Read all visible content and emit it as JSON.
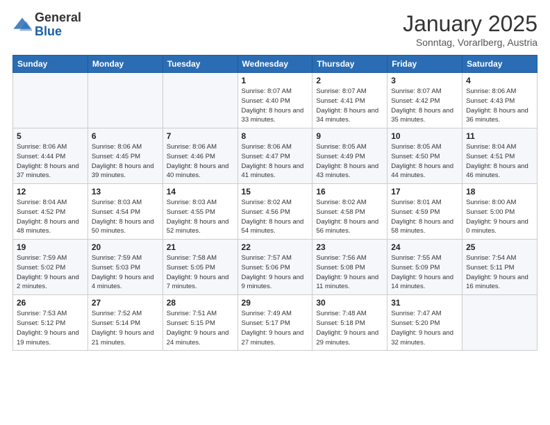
{
  "logo": {
    "general": "General",
    "blue": "Blue"
  },
  "header": {
    "month": "January 2025",
    "location": "Sonntag, Vorarlberg, Austria"
  },
  "weekdays": [
    "Sunday",
    "Monday",
    "Tuesday",
    "Wednesday",
    "Thursday",
    "Friday",
    "Saturday"
  ],
  "weeks": [
    [
      {
        "day": "",
        "info": ""
      },
      {
        "day": "",
        "info": ""
      },
      {
        "day": "",
        "info": ""
      },
      {
        "day": "1",
        "info": "Sunrise: 8:07 AM\nSunset: 4:40 PM\nDaylight: 8 hours\nand 33 minutes."
      },
      {
        "day": "2",
        "info": "Sunrise: 8:07 AM\nSunset: 4:41 PM\nDaylight: 8 hours\nand 34 minutes."
      },
      {
        "day": "3",
        "info": "Sunrise: 8:07 AM\nSunset: 4:42 PM\nDaylight: 8 hours\nand 35 minutes."
      },
      {
        "day": "4",
        "info": "Sunrise: 8:06 AM\nSunset: 4:43 PM\nDaylight: 8 hours\nand 36 minutes."
      }
    ],
    [
      {
        "day": "5",
        "info": "Sunrise: 8:06 AM\nSunset: 4:44 PM\nDaylight: 8 hours\nand 37 minutes."
      },
      {
        "day": "6",
        "info": "Sunrise: 8:06 AM\nSunset: 4:45 PM\nDaylight: 8 hours\nand 39 minutes."
      },
      {
        "day": "7",
        "info": "Sunrise: 8:06 AM\nSunset: 4:46 PM\nDaylight: 8 hours\nand 40 minutes."
      },
      {
        "day": "8",
        "info": "Sunrise: 8:06 AM\nSunset: 4:47 PM\nDaylight: 8 hours\nand 41 minutes."
      },
      {
        "day": "9",
        "info": "Sunrise: 8:05 AM\nSunset: 4:49 PM\nDaylight: 8 hours\nand 43 minutes."
      },
      {
        "day": "10",
        "info": "Sunrise: 8:05 AM\nSunset: 4:50 PM\nDaylight: 8 hours\nand 44 minutes."
      },
      {
        "day": "11",
        "info": "Sunrise: 8:04 AM\nSunset: 4:51 PM\nDaylight: 8 hours\nand 46 minutes."
      }
    ],
    [
      {
        "day": "12",
        "info": "Sunrise: 8:04 AM\nSunset: 4:52 PM\nDaylight: 8 hours\nand 48 minutes."
      },
      {
        "day": "13",
        "info": "Sunrise: 8:03 AM\nSunset: 4:54 PM\nDaylight: 8 hours\nand 50 minutes."
      },
      {
        "day": "14",
        "info": "Sunrise: 8:03 AM\nSunset: 4:55 PM\nDaylight: 8 hours\nand 52 minutes."
      },
      {
        "day": "15",
        "info": "Sunrise: 8:02 AM\nSunset: 4:56 PM\nDaylight: 8 hours\nand 54 minutes."
      },
      {
        "day": "16",
        "info": "Sunrise: 8:02 AM\nSunset: 4:58 PM\nDaylight: 8 hours\nand 56 minutes."
      },
      {
        "day": "17",
        "info": "Sunrise: 8:01 AM\nSunset: 4:59 PM\nDaylight: 8 hours\nand 58 minutes."
      },
      {
        "day": "18",
        "info": "Sunrise: 8:00 AM\nSunset: 5:00 PM\nDaylight: 9 hours\nand 0 minutes."
      }
    ],
    [
      {
        "day": "19",
        "info": "Sunrise: 7:59 AM\nSunset: 5:02 PM\nDaylight: 9 hours\nand 2 minutes."
      },
      {
        "day": "20",
        "info": "Sunrise: 7:59 AM\nSunset: 5:03 PM\nDaylight: 9 hours\nand 4 minutes."
      },
      {
        "day": "21",
        "info": "Sunrise: 7:58 AM\nSunset: 5:05 PM\nDaylight: 9 hours\nand 7 minutes."
      },
      {
        "day": "22",
        "info": "Sunrise: 7:57 AM\nSunset: 5:06 PM\nDaylight: 9 hours\nand 9 minutes."
      },
      {
        "day": "23",
        "info": "Sunrise: 7:56 AM\nSunset: 5:08 PM\nDaylight: 9 hours\nand 11 minutes."
      },
      {
        "day": "24",
        "info": "Sunrise: 7:55 AM\nSunset: 5:09 PM\nDaylight: 9 hours\nand 14 minutes."
      },
      {
        "day": "25",
        "info": "Sunrise: 7:54 AM\nSunset: 5:11 PM\nDaylight: 9 hours\nand 16 minutes."
      }
    ],
    [
      {
        "day": "26",
        "info": "Sunrise: 7:53 AM\nSunset: 5:12 PM\nDaylight: 9 hours\nand 19 minutes."
      },
      {
        "day": "27",
        "info": "Sunrise: 7:52 AM\nSunset: 5:14 PM\nDaylight: 9 hours\nand 21 minutes."
      },
      {
        "day": "28",
        "info": "Sunrise: 7:51 AM\nSunset: 5:15 PM\nDaylight: 9 hours\nand 24 minutes."
      },
      {
        "day": "29",
        "info": "Sunrise: 7:49 AM\nSunset: 5:17 PM\nDaylight: 9 hours\nand 27 minutes."
      },
      {
        "day": "30",
        "info": "Sunrise: 7:48 AM\nSunset: 5:18 PM\nDaylight: 9 hours\nand 29 minutes."
      },
      {
        "day": "31",
        "info": "Sunrise: 7:47 AM\nSunset: 5:20 PM\nDaylight: 9 hours\nand 32 minutes."
      },
      {
        "day": "",
        "info": ""
      }
    ]
  ]
}
